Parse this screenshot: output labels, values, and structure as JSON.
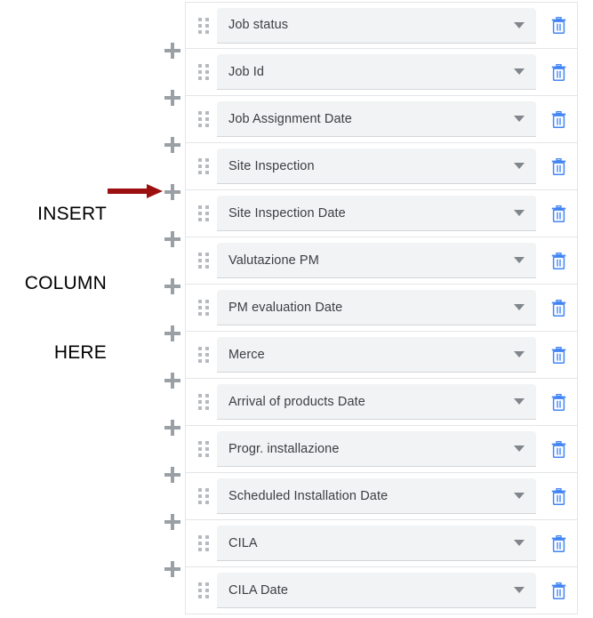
{
  "annotation": {
    "line1": "INSERT",
    "line2": "COLUMN",
    "line3": "HERE",
    "arrow_color": "#9c1010",
    "text_color": "#000000"
  },
  "colors": {
    "field_background": "#f1f3f4",
    "field_text": "#3c4043",
    "row_border": "#e3e5e8",
    "plus_icon": "#9aa0a6",
    "caret": "#80868b",
    "trash_icon": "#4285f4",
    "page_background": "#ffffff"
  },
  "insert_buttons": {
    "icon": "plus-icon",
    "count": 12,
    "highlighted_index": 4
  },
  "rows": [
    {
      "label": "Job status",
      "drag_icon": "drag-handle-icon",
      "caret_icon": "chevron-down-icon",
      "delete_icon": "trash-icon"
    },
    {
      "label": "Job Id",
      "drag_icon": "drag-handle-icon",
      "caret_icon": "chevron-down-icon",
      "delete_icon": "trash-icon"
    },
    {
      "label": "Job Assignment Date",
      "drag_icon": "drag-handle-icon",
      "caret_icon": "chevron-down-icon",
      "delete_icon": "trash-icon"
    },
    {
      "label": "Site Inspection",
      "drag_icon": "drag-handle-icon",
      "caret_icon": "chevron-down-icon",
      "delete_icon": "trash-icon"
    },
    {
      "label": "Site Inspection Date",
      "drag_icon": "drag-handle-icon",
      "caret_icon": "chevron-down-icon",
      "delete_icon": "trash-icon"
    },
    {
      "label": "Valutazione PM",
      "drag_icon": "drag-handle-icon",
      "caret_icon": "chevron-down-icon",
      "delete_icon": "trash-icon"
    },
    {
      "label": "PM evaluation Date",
      "drag_icon": "drag-handle-icon",
      "caret_icon": "chevron-down-icon",
      "delete_icon": "trash-icon"
    },
    {
      "label": "Merce",
      "drag_icon": "drag-handle-icon",
      "caret_icon": "chevron-down-icon",
      "delete_icon": "trash-icon"
    },
    {
      "label": "Arrival of products Date",
      "drag_icon": "drag-handle-icon",
      "caret_icon": "chevron-down-icon",
      "delete_icon": "trash-icon"
    },
    {
      "label": "Progr. installazione",
      "drag_icon": "drag-handle-icon",
      "caret_icon": "chevron-down-icon",
      "delete_icon": "trash-icon"
    },
    {
      "label": "Scheduled Installation Date",
      "drag_icon": "drag-handle-icon",
      "caret_icon": "chevron-down-icon",
      "delete_icon": "trash-icon"
    },
    {
      "label": "CILA",
      "drag_icon": "drag-handle-icon",
      "caret_icon": "chevron-down-icon",
      "delete_icon": "trash-icon"
    },
    {
      "label": "CILA Date",
      "drag_icon": "drag-handle-icon",
      "caret_icon": "chevron-down-icon",
      "delete_icon": "trash-icon"
    }
  ]
}
